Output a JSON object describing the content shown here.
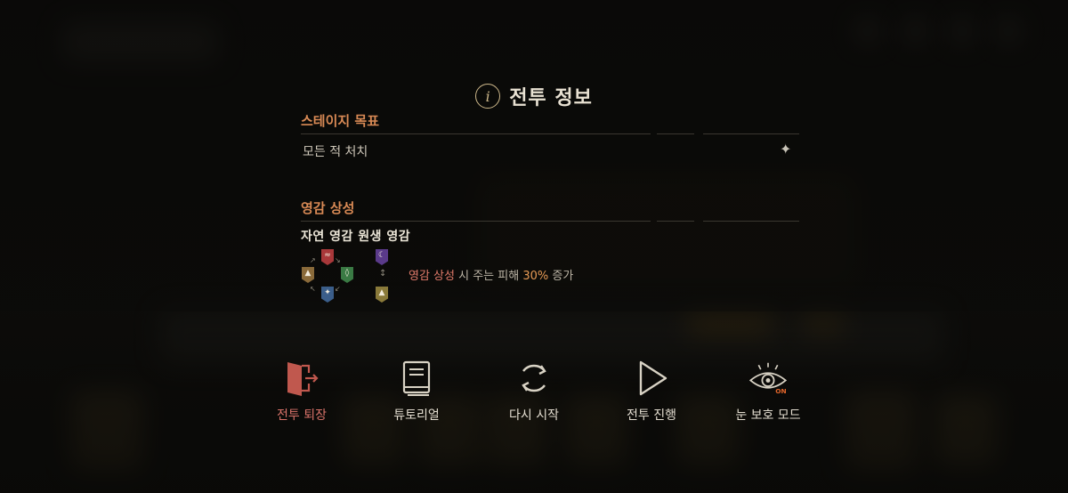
{
  "dialog": {
    "title": "전투 정보"
  },
  "stage_goal": {
    "header": "스테이지 목표",
    "objective": "모든 적 처치"
  },
  "affinity": {
    "header": "영감 상성",
    "label": "자연 영감 원생 영감",
    "desc_highlight": "영감 상성",
    "desc_middle": " 시 주는 피해 ",
    "desc_percent": "30%",
    "desc_end": " 증가"
  },
  "menu": {
    "exit": "전투 퇴장",
    "tutorial": "튜토리얼",
    "restart": "다시 시작",
    "resume": "전투 진행",
    "eye_care": "눈 보호 모드",
    "eye_badge": "ON"
  },
  "colors": {
    "accent_gold": "#cdb88a",
    "section_orange": "#d98a55",
    "exit_red": "#d9736a",
    "eye_on": "#e2652b"
  }
}
